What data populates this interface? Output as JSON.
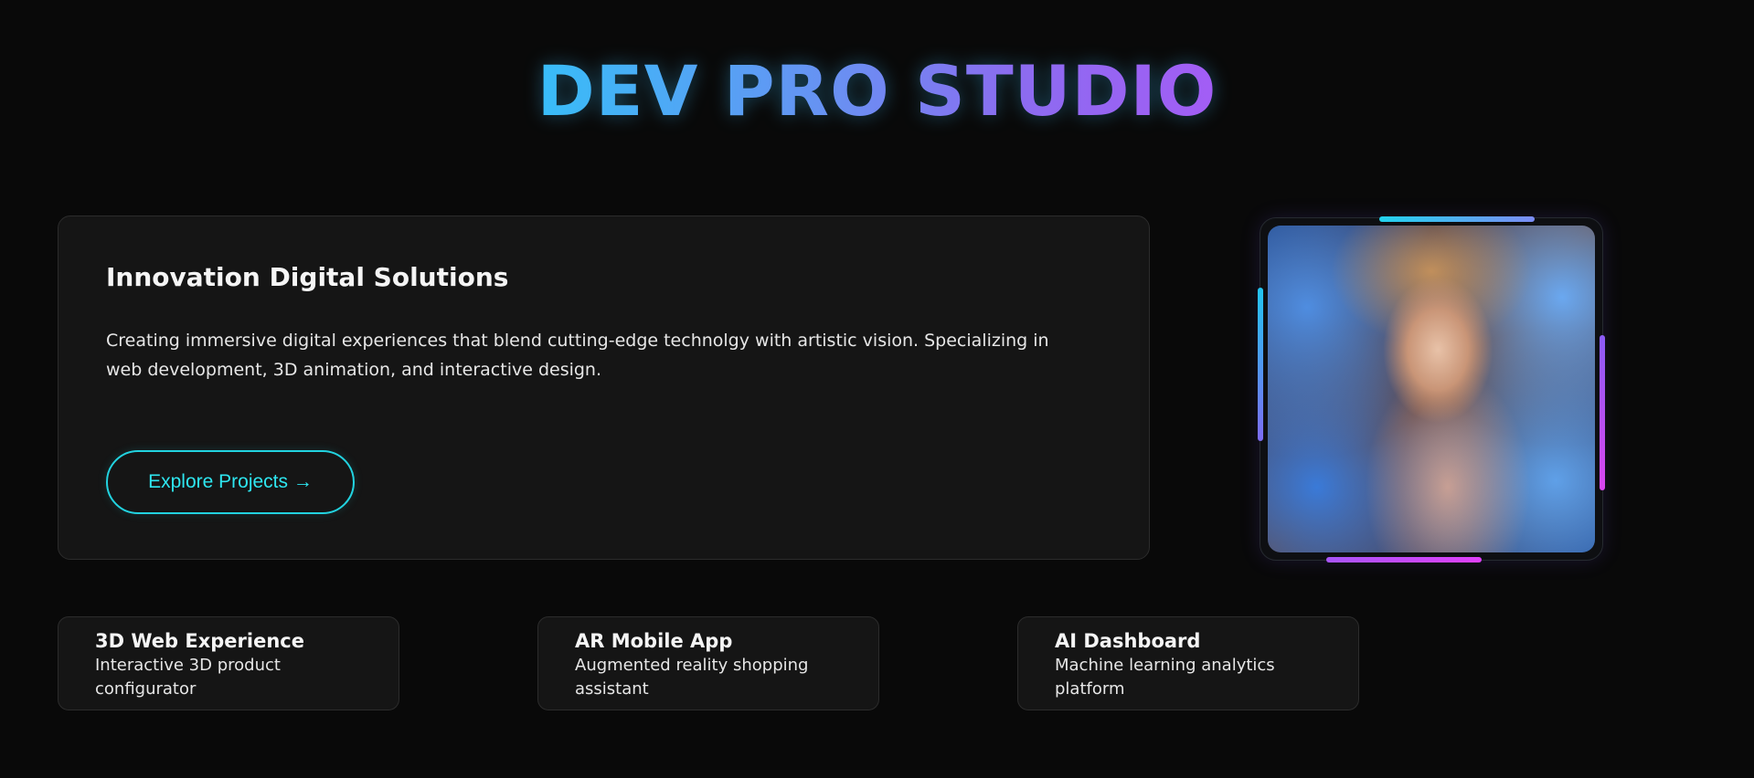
{
  "header": {
    "title": "DEV PRO STUDIO"
  },
  "hero": {
    "heading": "Innovation Digital Solutions",
    "description": "Creating immersive digital experiences that blend cutting-edge technolgy with artistic vision. Specializing in web development, 3D animation, and interactive design.",
    "cta_label": "Explore Projects →"
  },
  "showcase": {
    "image_subject": "fantasy portrait artwork"
  },
  "features": [
    {
      "title": "3D Web Experience",
      "description": "Interactive 3D product configurator"
    },
    {
      "title": "AR Mobile App",
      "description": "Augmented reality shopping assistant"
    },
    {
      "title": "AI Dashboard",
      "description": "Machine learning analytics platform"
    }
  ],
  "colors": {
    "background": "#090909",
    "card": "#151515",
    "accent_cyan": "#22d3e0",
    "accent_purple": "#a35df5",
    "title_gradient_start": "#38bdf8",
    "title_gradient_end": "#a35df5"
  }
}
